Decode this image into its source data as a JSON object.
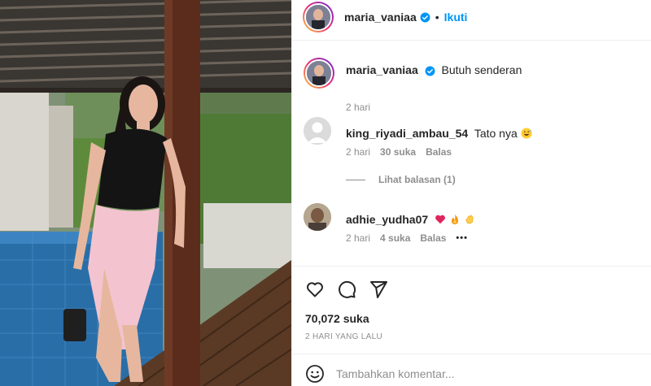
{
  "colors": {
    "accent": "#0095f6",
    "text": "#262626",
    "muted": "#8e8e8e",
    "heart_emoji": "#e0245e",
    "border": "#efefef"
  },
  "post": {
    "author": "maria_vaniaa",
    "verified": true,
    "follow_label": "Ikuti",
    "dot": "•"
  },
  "caption": {
    "username": "maria_vaniaa",
    "text": "Butuh senderan",
    "time": "2 hari"
  },
  "comments": [
    {
      "username": "king_riyadi_ambau_54",
      "text": "Tato nya",
      "emoji": [
        "grinning-sweat-emoji"
      ],
      "time": "2 hari",
      "likes": "30 suka",
      "reply_label": "Balas",
      "avatar": "default-avatar"
    },
    {
      "username": "adhie_yudha07",
      "text": "",
      "emoji": [
        "red-heart-emoji",
        "fire-emoji",
        "clapping-hands-emoji"
      ],
      "time": "2 hari",
      "likes": "4 suka",
      "reply_label": "Balas",
      "more": "•••",
      "avatar": "photo-avatar"
    }
  ],
  "view_replies": "Lihat balasan (1)",
  "actions": {
    "like_icon": "heart-icon",
    "comment_icon": "comment-icon",
    "share_icon": "send-icon"
  },
  "likes_count": "70,072 suka",
  "timestamp": "2 HARI YANG LALU",
  "comment_box": {
    "placeholder": "Tambahkan komentar...",
    "emoji_icon": "smiley-icon"
  }
}
